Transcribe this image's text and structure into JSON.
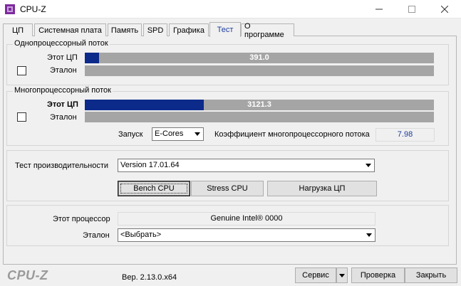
{
  "window": {
    "title": "CPU-Z",
    "minimize_icon": "minimize-icon",
    "maximize_icon": "maximize-icon",
    "close_icon": "close-icon"
  },
  "tabs": [
    {
      "label": "ЦП"
    },
    {
      "label": "Системная плата"
    },
    {
      "label": "Память"
    },
    {
      "label": "SPD"
    },
    {
      "label": "Графика"
    },
    {
      "label": "Тест"
    },
    {
      "label": "О программе"
    }
  ],
  "active_tab": "Тест",
  "single_thread": {
    "title": "Однопроцессорный поток",
    "this_cpu_label": "Этот ЦП",
    "this_cpu_score": "391.0",
    "this_cpu_fraction": 0.04,
    "reference_label": "Эталон",
    "reference_checked": false
  },
  "multi_thread": {
    "title": "Многопроцессорный поток",
    "this_cpu_label": "Этот ЦП",
    "this_cpu_score": "3121.3",
    "this_cpu_fraction": 0.34,
    "reference_label": "Эталон",
    "reference_checked": false,
    "launch_label": "Запуск",
    "launch_value": "E-Cores",
    "ratio_label": "Коэффициент многопроцессорного потока",
    "ratio_value": "7.98"
  },
  "benchmark": {
    "label": "Тест производительности",
    "version": "Version 17.01.64",
    "bench_button": "Bench CPU",
    "stress_button": "Stress CPU",
    "load_button": "Нагрузка ЦП"
  },
  "processor": {
    "this_label": "Этот процессор",
    "this_value": "Genuine Intel® 0000",
    "ref_label": "Эталон",
    "ref_value": "<Выбрать>"
  },
  "footer": {
    "logo": "CPU-Z",
    "version": "Вер. 2.13.0.x64",
    "service_button": "Сервис",
    "validate_button": "Проверка",
    "close_button": "Закрыть"
  },
  "colors": {
    "bar_fill": "#0b2a8a",
    "bar_bg": "#a5a5a5",
    "ratio_text": "#1c3c9c"
  }
}
